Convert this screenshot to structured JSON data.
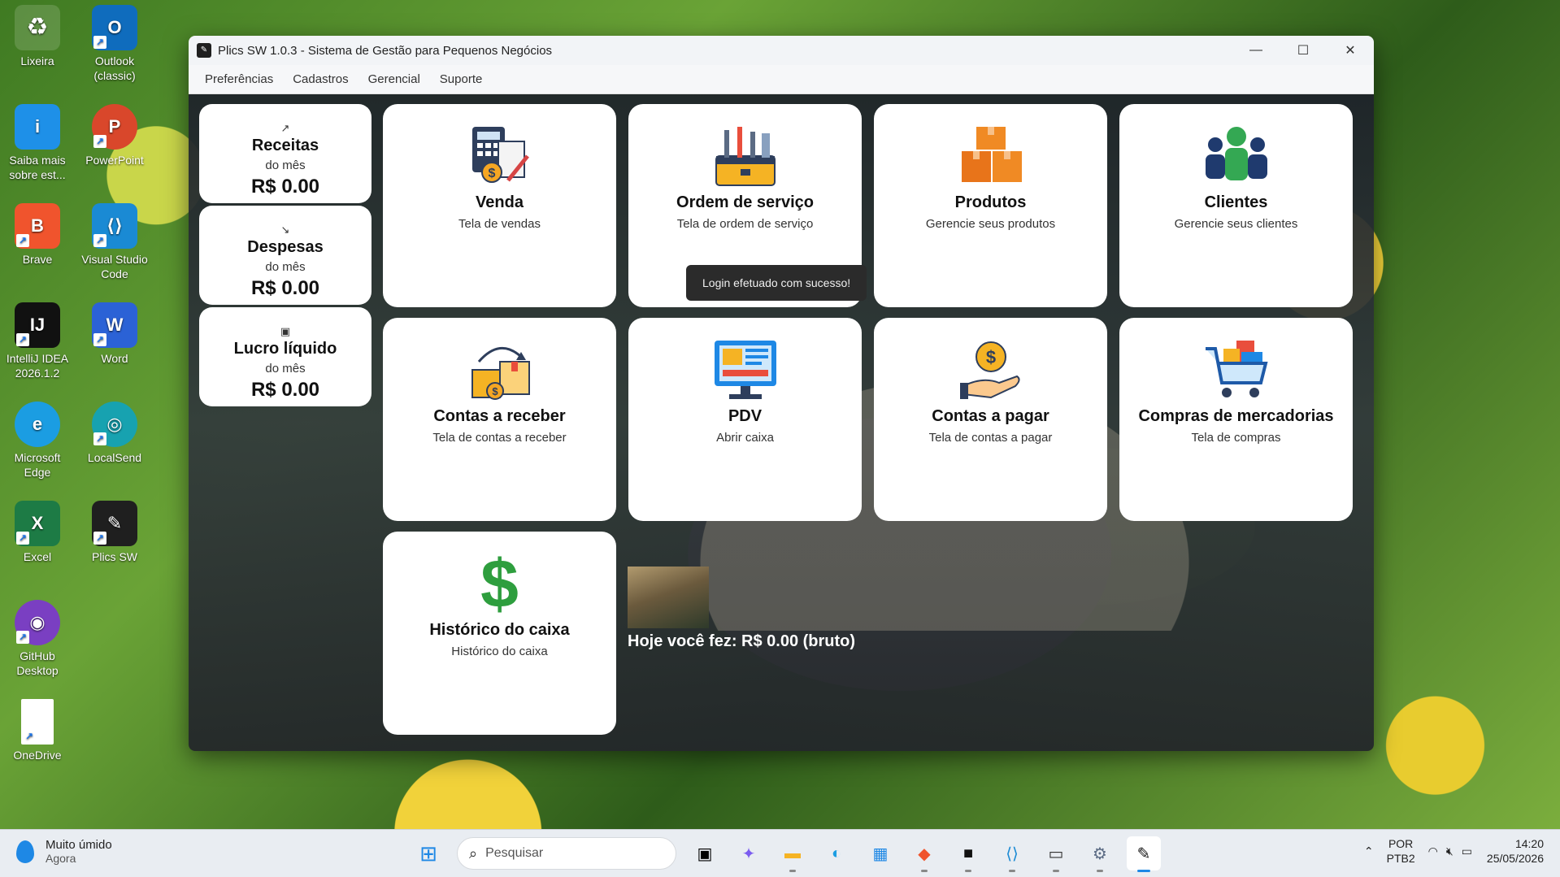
{
  "desktop": {
    "icons": [
      {
        "label": "Lixeira"
      },
      {
        "label": "Outlook (classic)"
      },
      {
        "label": "Saiba mais sobre est..."
      },
      {
        "label": "PowerPoint"
      },
      {
        "label": "Brave"
      },
      {
        "label": "Visual Studio Code"
      },
      {
        "label": "IntelliJ IDEA 2026.1.2"
      },
      {
        "label": "Word"
      },
      {
        "label": "Microsoft Edge"
      },
      {
        "label": "LocalSend"
      },
      {
        "label": "Excel"
      },
      {
        "label": "Plics SW"
      },
      {
        "label": "GitHub Desktop"
      },
      {
        "label": "OneDrive"
      }
    ]
  },
  "window": {
    "title": "Plics SW 1.0.3 - Sistema de Gestão para Pequenos Negócios",
    "menu": [
      "Preferências",
      "Cadastros",
      "Gerencial",
      "Suporte"
    ]
  },
  "summary": [
    {
      "title": "Receitas",
      "sub": "do mês",
      "value": "R$ 0.00",
      "icon": "trend-up-icon"
    },
    {
      "title": "Despesas",
      "sub": "do mês",
      "value": "R$ 0.00",
      "icon": "trend-down-icon"
    },
    {
      "title": "Lucro líquido",
      "sub": "do mês",
      "value": "R$ 0.00",
      "icon": "chart-icon"
    }
  ],
  "tiles": [
    {
      "title": "Venda",
      "sub": "Tela de vendas",
      "icon": "calculator-invoice-icon"
    },
    {
      "title": "Ordem de serviço",
      "sub": "Tela de ordem de serviço",
      "icon": "toolbox-icon"
    },
    {
      "title": "Produtos",
      "sub": "Gerencie seus produtos",
      "icon": "boxes-icon"
    },
    {
      "title": "Clientes",
      "sub": "Gerencie seus clientes",
      "icon": "people-icon"
    },
    {
      "title": "Contas a receber",
      "sub": "Tela de contas a receber",
      "icon": "receive-box-icon"
    },
    {
      "title": "PDV",
      "sub": "Abrir caixa",
      "icon": "monitor-icon"
    },
    {
      "title": "Contas a pagar",
      "sub": "Tela de contas a pagar",
      "icon": "hand-coin-icon"
    },
    {
      "title": "Compras de mercadorias",
      "sub": "Tela de compras",
      "icon": "cart-icon"
    },
    {
      "title": "Histórico do caixa",
      "sub": "Histórico do caixa",
      "icon": "dollar-icon"
    }
  ],
  "toast": "Login efetuado com sucesso!",
  "today_text": "Hoje você fez: R$ 0.00 (bruto)",
  "taskbar": {
    "weather_title": "Muito úmido",
    "weather_sub": "Agora",
    "search_placeholder": "Pesquisar",
    "lang_1": "POR",
    "lang_2": "PTB2",
    "time": "14:20",
    "date": "25/05/2026"
  },
  "colors": {
    "tile_bg": "#ffffff",
    "content_bg": "#2a2f36",
    "accent_green": "#2e9e3e"
  }
}
